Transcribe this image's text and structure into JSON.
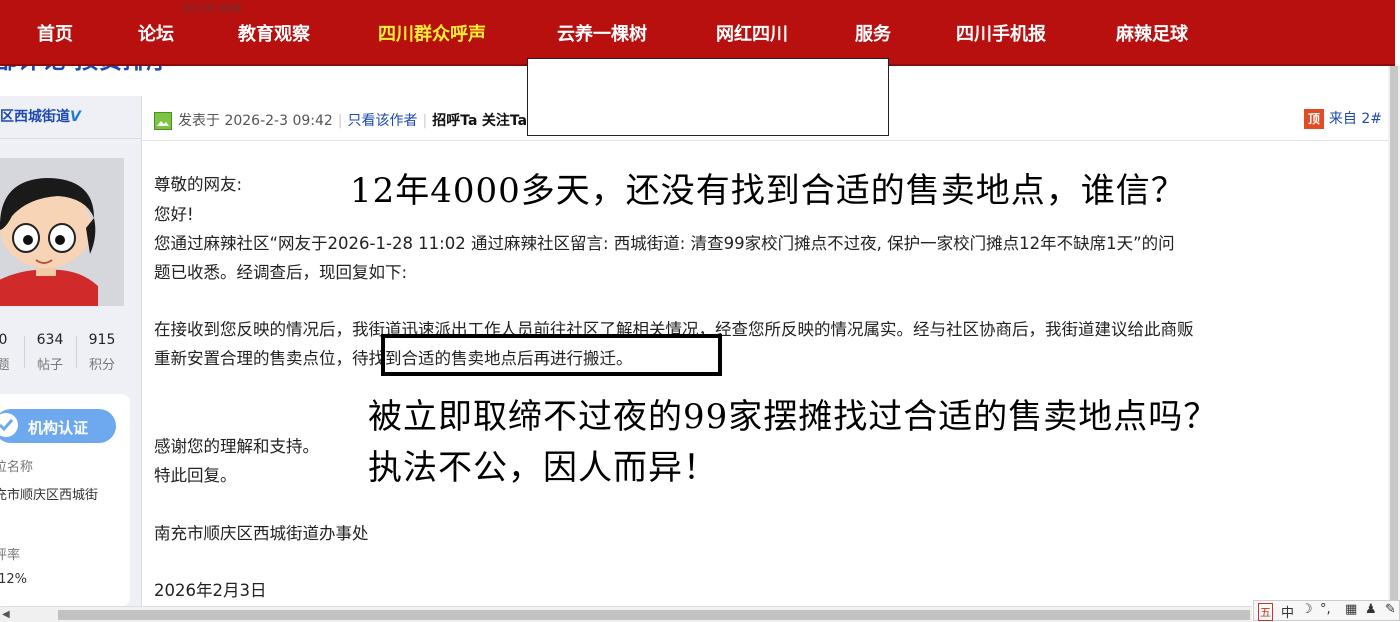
{
  "nav": {
    "faint_text": "四川网·麻辣",
    "items": [
      {
        "label": "首页",
        "highlight": false
      },
      {
        "label": "论坛",
        "highlight": false
      },
      {
        "label": "教育观察",
        "highlight": false
      },
      {
        "label": "四川群众呼声",
        "highlight": true
      },
      {
        "label": "云养一棵树",
        "highlight": false
      },
      {
        "label": "网红四川",
        "highlight": false
      },
      {
        "label": "服务",
        "highlight": false
      },
      {
        "label": "四川手机报",
        "highlight": false
      },
      {
        "label": "麻辣足球",
        "highlight": false
      }
    ]
  },
  "subtitle": "部评论  按赞排序",
  "sidebar": {
    "username": "区西城街道",
    "verified_mark": "V",
    "stats": [
      {
        "num": "0",
        "label": "题"
      },
      {
        "num": "634",
        "label": "帖子"
      },
      {
        "num": "915",
        "label": "积分"
      }
    ],
    "cert_label": "机构认证",
    "org_name_label": "位名称",
    "org_name_value": "充市顺庆区西城街",
    "rate_label": "评率",
    "rate_value": ".12%"
  },
  "post": {
    "posted_prefix": "发表于",
    "posted_time": "2026-2-3 09:42",
    "only_author": "只看该作者",
    "greet": "招呼Ta",
    "follow": "关注Ta",
    "floor_prefix": "来自",
    "floor": "2#",
    "top_icon": "顶",
    "lines": {
      "l1": "尊敬的网友:",
      "l2": "您好!",
      "l3": "您通过麻辣社区“网友于2026-1-28 11:02 通过麻辣社区留言: 西城街道: 清查99家校门摊点不过夜, 保护一家校门摊点12年不缺席1天”的问",
      "l4": "题已收悉。经调查后，现回复如下:",
      "l5": "在接收到您反映的情况后，我街道迅速派出工作人员前往社区了解相关情况，经查您所反映的情况属实。经与社区协商后，我街道建议给此商贩",
      "l6": "重新安置合理的售卖点位，待找到合适的售卖地点后再进行搬迁。",
      "l7": "感谢您的理解和支持。",
      "l8": "特此回复。",
      "l9": "南充市顺庆区西城街道办事处",
      "l10": "2026年2月3日"
    }
  },
  "annotations": {
    "a1": "12年4000多天，还没有找到合适的售卖地点，谁信？",
    "a2": "被立即取缔不过夜的99家摆摊找过合适的售卖地点吗？",
    "a3": "执法不公，因人而异！"
  },
  "ime": {
    "items": [
      "五",
      "中",
      "☽",
      "°,",
      "▦",
      "♟",
      "✎"
    ]
  }
}
